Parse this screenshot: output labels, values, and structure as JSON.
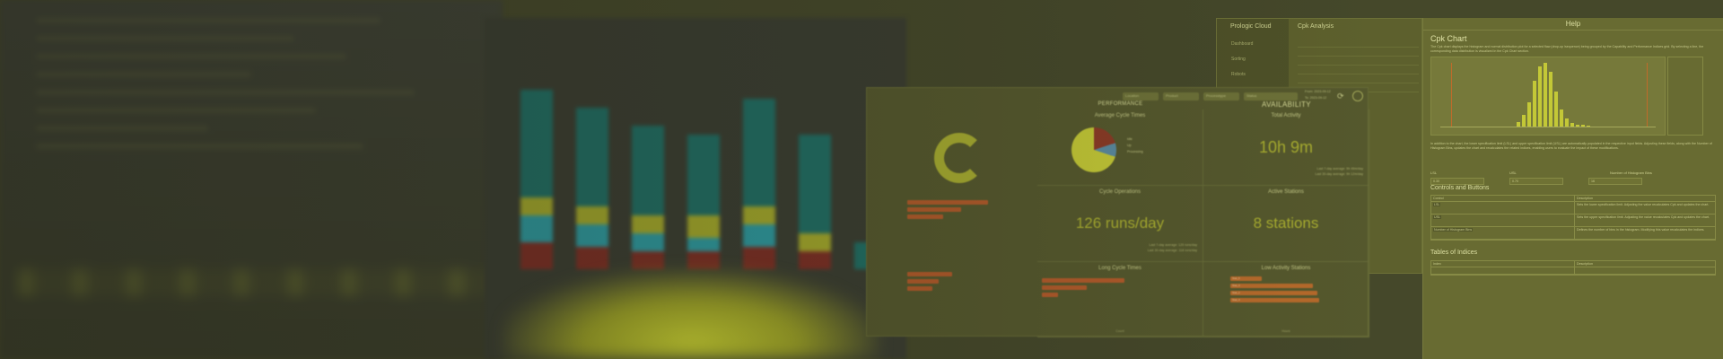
{
  "dashboard": {
    "filters": [
      "Location",
      "Product",
      "Processtype",
      "Status"
    ],
    "date_range": [
      "From: 2023-09-12",
      "To: 2023-09-12"
    ],
    "section_left": "PERFORMANCE",
    "section_right": "AVAILABILITY",
    "cells": {
      "avg_cycle_time": {
        "title": "Average Cycle Times",
        "legend": [
          "Idle",
          "Up",
          "Processing"
        ]
      },
      "total_activity": {
        "title": "Total Activity",
        "value": "10h 9m",
        "note1": "Last 7-day average: 9h 49m/day",
        "note2": "Last 30-day average: 9h 12m/day"
      },
      "cycle_operations": {
        "title": "Cycle Operations",
        "value": "126 runs/day",
        "note1": "Last 7-day average: 120 runs/day",
        "note2": "Last 30-day average: 118 runs/day"
      },
      "active_stations": {
        "title": "Active Stations",
        "value": "8 stations"
      },
      "long_cycle_times": {
        "title": "Long Cycle Times",
        "axis": "Count"
      },
      "low_activity_stations": {
        "title": "Low Activity Stations",
        "bars": [
          "Stat_5",
          "Stat_3",
          "Stat_2",
          "Stat_4"
        ],
        "axis": "Hours"
      }
    }
  },
  "cpk": {
    "sidebar_title": "Prologic Cloud",
    "sidebar_items": [
      "Dashboard",
      "Sorting",
      "Robots"
    ],
    "heading": "Cpk Analysis"
  },
  "help": {
    "title": "Help",
    "h1": "Cpk Chart",
    "intro": "The Cpk chart displays the histogram and normal distribution plot for a selected flaw (drop-up /sequence) being grouped by the Capability and Performance Indices grid. By selecting a line, the corresponding data distribution is visualized in the Cpk Chart section.",
    "para2": "In addition to the chart, the lower specification limit (LSL) and upper specification limit (USL) are automatically populated in the respective input fields. Adjusting these fields, along with the Number of Histogram Bins, updates the chart and recalculates the related indices, enabling users to evaluate the impact of these modifications.",
    "inputs": [
      {
        "label": "LSL",
        "value": "0.30"
      },
      {
        "label": "USL",
        "value": "0.70"
      },
      {
        "label": "Number of Histogram Bins",
        "value": "16"
      }
    ],
    "controls_title": "Controls and Buttons",
    "controls_header": [
      "Control",
      "Description"
    ],
    "controls_rows": [
      [
        "LSL",
        "Sets the lower specification limit. Adjusting the value recalculates Cpk and updates the chart."
      ],
      [
        "USL",
        "Sets the upper specification limit. Adjusting the value recalculates Cpk and updates the chart."
      ],
      [
        "Number of Histogram Bins",
        "Defines the number of bins in the histogram. Modifying this value recalculates the indices."
      ]
    ],
    "indices_title": "Tables of Indices",
    "indices_header": [
      "Index",
      "Description"
    ]
  }
}
